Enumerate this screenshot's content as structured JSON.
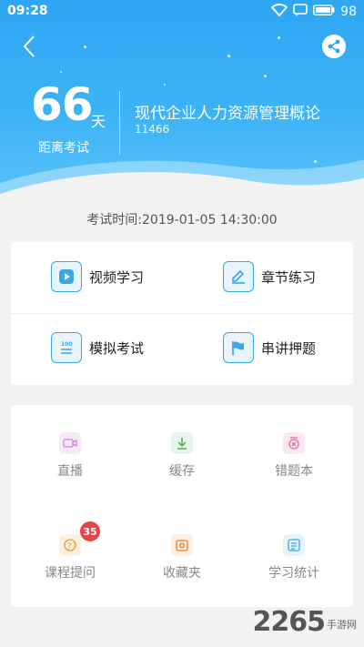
{
  "status": {
    "time": "09:28",
    "battery": "98"
  },
  "header": {
    "days": "66",
    "days_unit": "天",
    "days_label": "距离考试",
    "course_title": "现代企业人力资源管理概论",
    "course_code": "11466"
  },
  "exam_time": "考试时间:2019-01-05 14:30:00",
  "features": [
    {
      "label": "视频学习",
      "icon": "play-icon"
    },
    {
      "label": "章节练习",
      "icon": "edit-icon"
    },
    {
      "label": "模拟考试",
      "icon": "exam-paper-icon"
    },
    {
      "label": "串讲押题",
      "icon": "flag-icon"
    }
  ],
  "tools": [
    {
      "label": "直播",
      "icon": "live-video-icon",
      "color": "#c986d6"
    },
    {
      "label": "缓存",
      "icon": "download-icon",
      "color": "#4caf50"
    },
    {
      "label": "错题本",
      "icon": "wrong-questions-icon",
      "color": "#e06aa0"
    },
    {
      "label": "课程提问",
      "icon": "question-icon",
      "color": "#e39a2d",
      "badge": "35"
    },
    {
      "label": "收藏夹",
      "icon": "favorites-icon",
      "color": "#e07b2d"
    },
    {
      "label": "学习统计",
      "icon": "statistics-icon",
      "color": "#3aa6e6"
    }
  ],
  "watermark": {
    "number": "2265",
    "site": "手游网"
  }
}
